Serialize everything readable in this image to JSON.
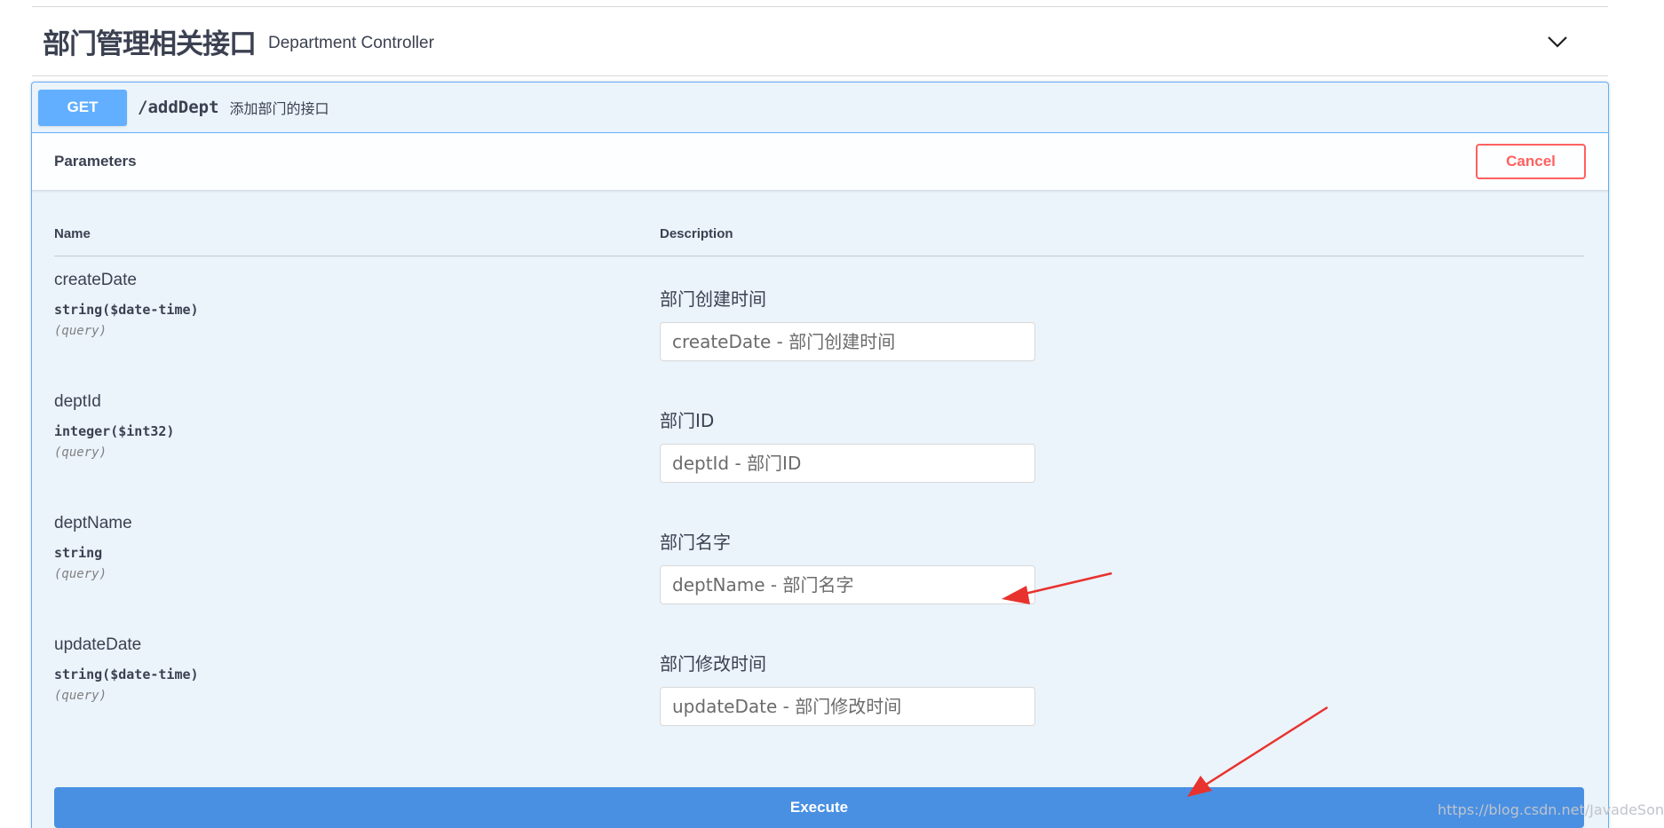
{
  "tag": {
    "title": "部门管理相关接口",
    "description": "Department Controller",
    "toggle_icon": "chevron-down-icon"
  },
  "operation": {
    "method": "GET",
    "path": "/addDept",
    "summary": "添加部门的接口"
  },
  "parameters_section": {
    "title": "Parameters",
    "cancel_label": "Cancel",
    "column_name": "Name",
    "column_description": "Description"
  },
  "parameters": [
    {
      "name": "createDate",
      "type": "string($date-time)",
      "in": "(query)",
      "description": "部门创建时间",
      "placeholder": "createDate - 部门创建时间"
    },
    {
      "name": "deptId",
      "type": "integer($int32)",
      "in": "(query)",
      "description": "部门ID",
      "placeholder": "deptId - 部门ID"
    },
    {
      "name": "deptName",
      "type": "string",
      "in": "(query)",
      "description": "部门名字",
      "placeholder": "deptName - 部门名字"
    },
    {
      "name": "updateDate",
      "type": "string($date-time)",
      "in": "(query)",
      "description": "部门修改时间",
      "placeholder": "updateDate - 部门修改时间"
    }
  ],
  "execute_label": "Execute",
  "watermark": "https://blog.csdn.net/JavadeSon",
  "colors": {
    "get_blue": "#61affe",
    "execute_blue": "#4990e2",
    "cancel_red": "#ff6060",
    "annotation_red": "#e8322e",
    "opblock_bg": "#ebf3fb"
  }
}
